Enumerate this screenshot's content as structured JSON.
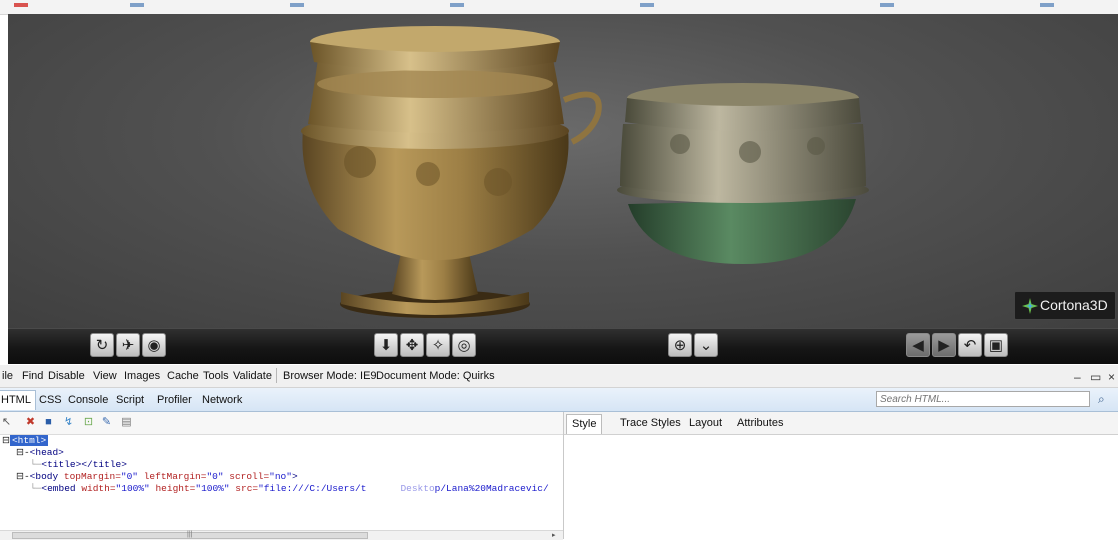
{
  "viewer": {
    "brand": "Cortona3D",
    "controls": [
      {
        "name": "rotate-icon",
        "glyph": "↻"
      },
      {
        "name": "fly-icon",
        "glyph": "✈"
      },
      {
        "name": "eye-icon",
        "glyph": "◉"
      },
      {
        "name": "walk-down-icon",
        "glyph": "⬇"
      },
      {
        "name": "pan-icon",
        "glyph": "✥"
      },
      {
        "name": "study-icon",
        "glyph": "✧"
      },
      {
        "name": "orbit-icon",
        "glyph": "◎"
      },
      {
        "name": "target-icon",
        "glyph": "⊕"
      },
      {
        "name": "straighten-icon",
        "glyph": "⌄"
      },
      {
        "name": "prev-viewpoint-icon",
        "glyph": "◀"
      },
      {
        "name": "next-viewpoint-icon",
        "glyph": "▶"
      },
      {
        "name": "undo-icon",
        "glyph": "↶"
      },
      {
        "name": "fit-icon",
        "glyph": "▣"
      }
    ]
  },
  "menubar": {
    "items": [
      "ile",
      "Find",
      "Disable",
      "View",
      "Images",
      "Cache",
      "Tools",
      "Validate"
    ],
    "browser_mode": "Browser Mode: IE9",
    "document_mode": "Document Mode: Quirks"
  },
  "tabs": {
    "items": [
      "HTML",
      "CSS",
      "Console",
      "Script",
      "Profiler",
      "Network"
    ],
    "active": "HTML",
    "search_placeholder": "Search HTML..."
  },
  "right_tabs": {
    "items": [
      "Style",
      "Trace Styles",
      "Layout",
      "Attributes"
    ],
    "active": "Style"
  },
  "tree": {
    "html": "<html>",
    "head": "<head>",
    "title": "<title></title>",
    "body_tag": "<body",
    "body_attr1": " topMargin=",
    "body_val1": "\"0\"",
    "body_attr2": " leftMargin=",
    "body_val2": "\"0\"",
    "body_attr3": " scroll=",
    "body_val3": "\"no\"",
    "body_close": ">",
    "embed_tag": "<embed",
    "embed_attr1": " width=",
    "embed_val1": "\"100%\"",
    "embed_attr2": " height=",
    "embed_val2": "\"100%\"",
    "embed_attr3": " src=",
    "embed_val3": "\"file:///C:/Users/t",
    "embed_val3b": "Deskto",
    "embed_val3c": "p/Lana%20Madracevic/"
  },
  "colors": {
    "bronze": "#a88a4e",
    "green_patina": "#3f6b4a",
    "selection": "#3366cc"
  }
}
